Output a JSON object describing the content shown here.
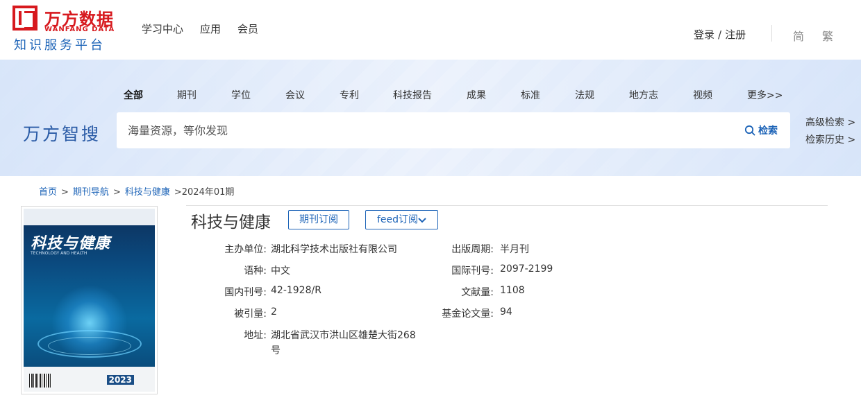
{
  "header": {
    "logo_cn": "万方数据",
    "logo_en": "WANFANG DATA",
    "logo_sub": "知识服务平台",
    "nav": [
      "学习中心",
      "应用",
      "会员"
    ],
    "login": "登录",
    "login_sep": "/",
    "register": "注册",
    "lang_simplified": "简",
    "lang_traditional": "繁"
  },
  "search": {
    "categories": [
      "全部",
      "期刊",
      "学位",
      "会议",
      "专利",
      "科技报告",
      "成果",
      "标准",
      "法规",
      "地方志",
      "视频",
      "更多>>"
    ],
    "active_category": "全部",
    "brand": "万方智搜",
    "placeholder": "海量资源，等你发现",
    "button_label": "检索",
    "advanced": "高级检索 >",
    "history": "检索历史 >"
  },
  "breadcrumb": {
    "home": "首页",
    "journal_nav": "期刊导航",
    "journal": "科技与健康",
    "issue": ">2024年01期",
    "separator": ">"
  },
  "cover": {
    "title": "科技与健康",
    "subtitle_en": "TECHNOLOGY AND HEALTH",
    "year": "2023"
  },
  "journal": {
    "title": "科技与健康",
    "subscribe_button": "期刊订阅",
    "feed_button": "feed订阅",
    "fields": {
      "sponsor_label": "主办单位:",
      "sponsor": "湖北科学技术出版社有限公司",
      "language_label": "语种:",
      "language": "中文",
      "cn_label": "国内刊号:",
      "cn": "42-1928/R",
      "cited_label": "被引量:",
      "cited": "2",
      "address_label": "地址:",
      "address_line1": "湖北省武汉市洪山区雄楚大街268",
      "address_line2": "号",
      "cycle_label": "出版周期:",
      "cycle": "半月刊",
      "issn_label": "国际刊号:",
      "issn": "2097-2199",
      "docs_label": "文献量:",
      "docs": "1108",
      "fund_label": "基金论文量:",
      "fund": "94"
    }
  }
}
